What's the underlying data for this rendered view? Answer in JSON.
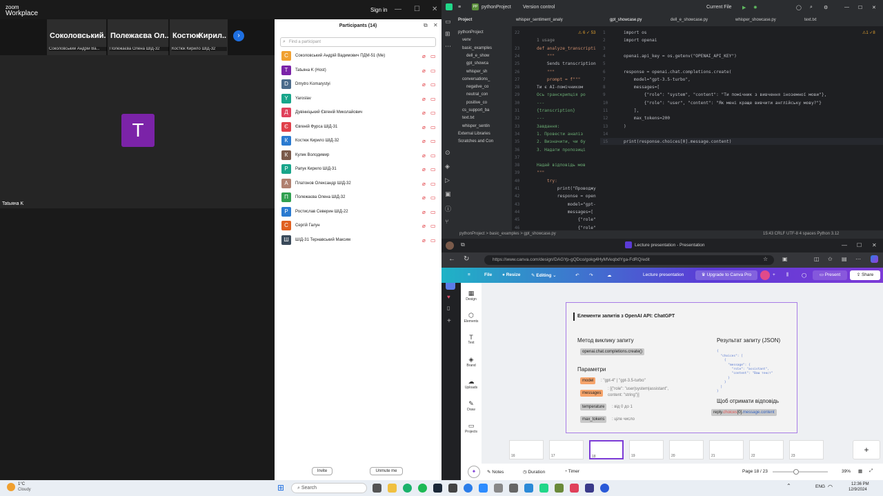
{
  "zoom": {
    "logo_line1": "zoom",
    "logo_line2": "Workplace",
    "sign_in": "Sign in",
    "tiles": [
      {
        "name": "Соколовський...",
        "tag": "Соколовський Андрій Ва..."
      },
      {
        "name": "Полежаєва Ол...",
        "tag": "Полежаєва Олена ШІД-32"
      },
      {
        "name": "Костюк",
        "tag": "Костюк Кирило ШІД-32"
      },
      {
        "name": "Кирил...",
        "tag": ""
      }
    ],
    "main_avatar_letter": "T",
    "main_name": "Tatьяна K",
    "participants_title": "Participants (14)",
    "search_placeholder": "Find a participant",
    "participants": [
      {
        "letter": "С",
        "name": "Соколовський Андрій Вадимович ПДМ-51 (Me)",
        "color": "#f0a030"
      },
      {
        "letter": "T",
        "name": "Tatьяна K (Host)",
        "color": "#7b23a8"
      },
      {
        "letter": "D",
        "name": "Dmytro Komarystyi",
        "color": "#4a6a8a"
      },
      {
        "letter": "Y",
        "name": "Yaroslav",
        "color": "#18a58a"
      },
      {
        "letter": "Д",
        "name": "Дувінніцький Євгеній Миколайович",
        "color": "#e0405a"
      },
      {
        "letter": "Є",
        "name": "Євгеній Фурса ШІД-31",
        "color": "#e0404a"
      },
      {
        "letter": "К",
        "name": "Костюк Кирило ШІД-32",
        "color": "#2a7ad0"
      },
      {
        "letter": "К",
        "name": "Кулик Володимир",
        "color": "#7a5a4a"
      },
      {
        "letter": "Р",
        "name": "Рапук Кирило ШІД-31",
        "color": "#18a58a"
      },
      {
        "letter": "А",
        "name": "Платонов Олександр ШІД-32",
        "color": "#b08070"
      },
      {
        "letter": "П",
        "name": "Полежаєва Олена ШІД-32",
        "color": "#30a050"
      },
      {
        "letter": "Р",
        "name": "Ростислав Северин ШІД-22",
        "color": "#2a7ad0"
      },
      {
        "letter": "С",
        "name": "Сергій Галун",
        "color": "#e06020"
      },
      {
        "letter": "Ш",
        "name": "ШІД-31 Тернавський Максим",
        "color": "#3a4a5a"
      }
    ],
    "invite": "Invite",
    "unmute": "Unmute me"
  },
  "ide": {
    "project": "pythonProject",
    "vcs": "Version control",
    "run_config": "Current File",
    "panel_title": "Project",
    "tree": [
      "pythonProject",
      "venv",
      "basic_examples",
      "dell_e_show",
      "gpt_showca",
      "whisper_sh",
      "conversations_",
      "negative_co",
      "neutral_con",
      "positive_co",
      "cs_support_ba",
      "text.txt",
      "whisper_sentin",
      "External Libraries",
      "Scratches and Con"
    ],
    "tabs": [
      "whisper_sentiment_analy",
      "gpt_showcase.py",
      "dell_e_showcase.py",
      "whisper_showcase.py",
      "text.txt"
    ],
    "left_code": [
      {
        "n": "22",
        "t": ""
      },
      {
        "n": "",
        "t": "1 usage"
      },
      {
        "n": "23",
        "t": "def analyze_transcripti"
      },
      {
        "n": "24",
        "t": "    \"\"\""
      },
      {
        "n": "25",
        "t": "    Sends transcription"
      },
      {
        "n": "26",
        "t": "    \"\"\""
      },
      {
        "n": "27",
        "t": "    prompt = f\"\"\""
      },
      {
        "n": "28",
        "t": "Ти є AI-помічником"
      },
      {
        "n": "29",
        "t": "Ось транскрипція ро"
      },
      {
        "n": "30",
        "t": "---"
      },
      {
        "n": "31",
        "t": "{transcription}"
      },
      {
        "n": "32",
        "t": "---"
      },
      {
        "n": "33",
        "t": "Завдання:"
      },
      {
        "n": "34",
        "t": "1. Провести аналіз"
      },
      {
        "n": "35",
        "t": "2. Визначити, чи бу"
      },
      {
        "n": "36",
        "t": "3. Надати пропозиці"
      },
      {
        "n": "37",
        "t": ""
      },
      {
        "n": "38",
        "t": "Надай відповідь мов"
      },
      {
        "n": "39",
        "t": "\"\"\""
      },
      {
        "n": "40",
        "t": "    try:"
      },
      {
        "n": "41",
        "t": "        print(\"Проводжу"
      },
      {
        "n": "42",
        "t": "        response = open"
      },
      {
        "n": "43",
        "t": "            model=\"gpt-"
      },
      {
        "n": "44",
        "t": "            messages=["
      },
      {
        "n": "45",
        "t": "                {\"role\""
      },
      {
        "n": "46",
        "t": "                {\"role\""
      }
    ],
    "code": [
      {
        "n": "1",
        "t": "import os"
      },
      {
        "n": "2",
        "t": "import openai"
      },
      {
        "n": "3",
        "t": ""
      },
      {
        "n": "4",
        "t": "openai.api_key = os.getenv(\"OPENAI_API_KEY\")"
      },
      {
        "n": "5",
        "t": ""
      },
      {
        "n": "6",
        "t": "response = openai.chat.completions.create("
      },
      {
        "n": "7",
        "t": "    model=\"gpt-3.5-turbo\","
      },
      {
        "n": "8",
        "t": "    messages=["
      },
      {
        "n": "9",
        "t": "        {\"role\": \"system\", \"content\": \"Ти помічник з вивчення іноземної мови\"},"
      },
      {
        "n": "10",
        "t": "        {\"role\": \"user\", \"content\": \"Як мені краще вивчити англійську мову?\"}"
      },
      {
        "n": "11",
        "t": "    ],"
      },
      {
        "n": "12",
        "t": "    max_tokens=200"
      },
      {
        "n": "13",
        "t": ")"
      },
      {
        "n": "14",
        "t": ""
      },
      {
        "n": "15",
        "t": "print(response.choices[0].message.content)"
      }
    ],
    "status_path": "pythonProject  >  basic_examples  >  gpt_showcase.py",
    "status_right": "15:43   CRLF   UTF-8   4 spaces   Python 3.12"
  },
  "browser": {
    "tab_title": "Lecture presentation - Presentation",
    "url": "https://www.canva.com/design/DAGYp-gQDco/gokg4HyMVeqbdYga-FdRQ/edit",
    "menu": [
      "File",
      "Resize",
      "Editing"
    ],
    "doc_title": "Lecture presentation",
    "upgrade": "Upgrade to Canva Pro",
    "present": "Present",
    "share": "Share",
    "side": [
      "Design",
      "Elements",
      "Text",
      "Brand",
      "Uploads",
      "Draw",
      "Projects"
    ],
    "slide": {
      "title": "Елементи запитів з OpenAI API: ChatGPT",
      "method_h": "Метод виклику запиту",
      "method": "openai.chat.completions.create()",
      "params_h": "Параметри",
      "p_model": "model",
      "p_model_v": ": \"gpt-4\" | \"gpt-3.5-turbo\"",
      "p_messages": "messages",
      "p_messages_v1": ": [{\"role\": \"user|system|assistant\",",
      "p_messages_v2": "content: \"string\"}]",
      "p_temp": "temperature",
      "p_temp_v": ": від 0 до 1",
      "p_max": "max_tokens",
      "p_max_v": ": ціле число",
      "result_h": "Результат запиту (JSON)",
      "json1": "{",
      "json2": "  \"choices\": [",
      "json3": "    {",
      "json4": "      \"message\": {",
      "json5": "        \"role\": \"assistant\",",
      "json6": "        \"content\": \"Ваш текст\"",
      "json7": "      }",
      "json8": "    }",
      "json9": "  ]",
      "json10": "}",
      "get_h": "Щоб отримати відповідь",
      "get_a": "reply.",
      "get_b": "choices",
      "get_c": "[0].",
      "get_d": "message.",
      "get_e": "content"
    },
    "thumb_nums": [
      "16",
      "17",
      "18",
      "19",
      "20",
      "21",
      "22",
      "23"
    ],
    "notes": "Notes",
    "duration": "Duration",
    "timer": "Timer",
    "page": "Page 18 / 23",
    "zoom": "39%"
  },
  "taskbar": {
    "weather_temp": "1°C",
    "weather_text": "Cloudy",
    "search": "Search",
    "lang": "ENG",
    "time": "12:36 PM",
    "date": "12/9/2024"
  }
}
